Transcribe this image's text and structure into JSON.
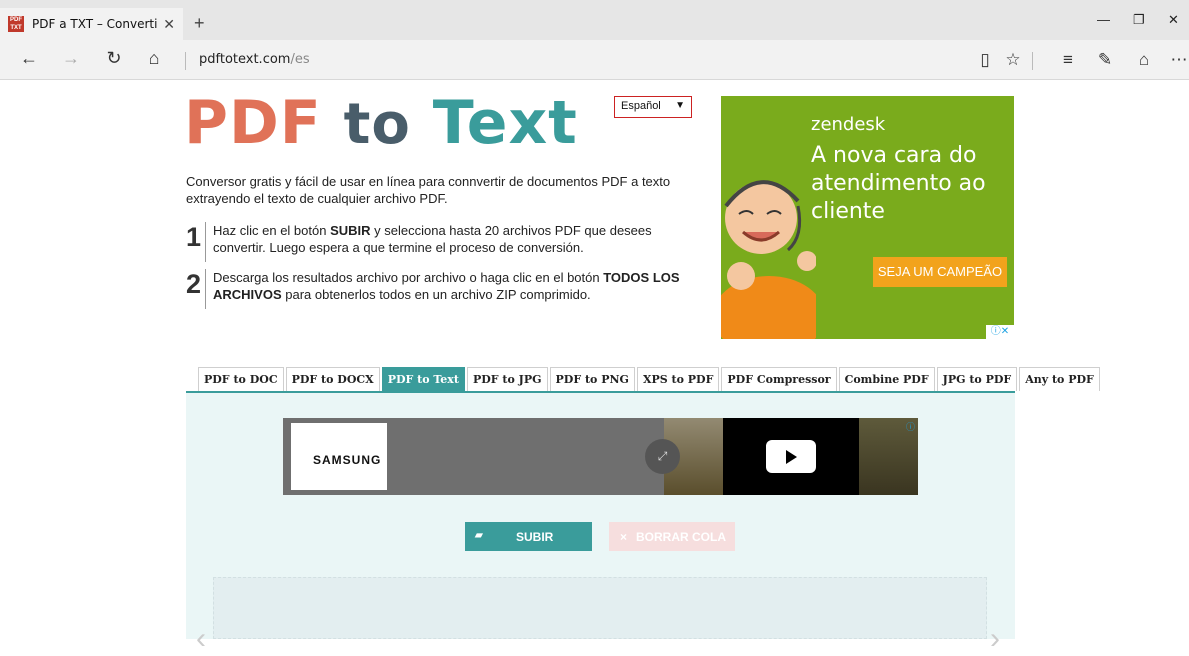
{
  "browser": {
    "tab_title": "PDF a TXT – Convertir P",
    "tab_favicon": "PDF TXT",
    "url_host": "pdftotext.com",
    "url_path": "/es"
  },
  "page": {
    "logo_pdf": "PDF",
    "logo_to": "to",
    "logo_text": "Text",
    "language": "Español",
    "intro": "Conversor gratis y fácil de usar en línea para connvertir de documentos PDF a texto extrayendo el texto de cualquier archivo PDF.",
    "steps": [
      {
        "num": "1",
        "pre": "Haz clic en el botón ",
        "bold": "SUBIR",
        "post": " y selecciona hasta 20 archivos PDF que desees convertir. Luego espera a que termine el proceso de conversión."
      },
      {
        "num": "2",
        "pre": "Descarga los resultados archivo por archivo o haga clic en el botón ",
        "bold": "TODOS LOS ARCHIVOS",
        "post": " para obtenerlos todos en un archivo ZIP comprimido."
      }
    ],
    "tools": [
      "PDF to DOC",
      "PDF to DOCX",
      "PDF to Text",
      "PDF to JPG",
      "PDF to PNG",
      "XPS to PDF",
      "PDF Compressor",
      "Combine PDF",
      "JPG to PDF",
      "Any to PDF"
    ],
    "active_tool": "PDF to Text",
    "upload_label": "SUBIR",
    "clear_label": "BORRAR COLA"
  },
  "ad": {
    "brand": "zendesk",
    "headline": "A nova cara do atendimento ao cliente",
    "cta": "SEJA UM CAMPEÃO"
  },
  "video_ad": {
    "brand": "SAMSUNG"
  },
  "colors": {
    "accent": "#3a9c9b",
    "logo_pdf": "#e07258",
    "logo_to": "#495d6a",
    "ad_green": "#7aab1c",
    "ad_orange": "#f2a31c"
  }
}
